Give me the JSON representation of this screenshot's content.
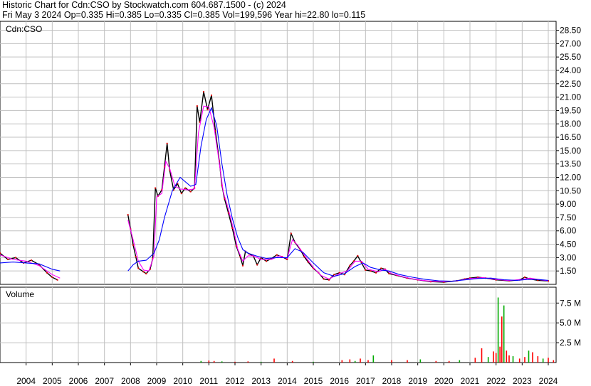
{
  "header": {
    "line1": "Historic Chart for Cdn:CSO by Stockwatch.com 604.687.1500 - (c) 2024",
    "line2": "Fri May  3 2024   Op=0.335   Hi=0.385   Lo=0.335   Cl=0.385   Vol=199,596   Year hi=22.80   lo=0.115"
  },
  "chart_data": [
    {
      "type": "line",
      "panel": "price",
      "label": "Cdn:CSO",
      "ylim": [
        0,
        29.5
      ],
      "y_ticks": [
        1.5,
        3.0,
        4.5,
        6.0,
        7.5,
        9.0,
        10.5,
        12.0,
        13.5,
        15.0,
        16.5,
        18.0,
        19.5,
        21.0,
        22.5,
        24.0,
        25.5,
        27.0,
        28.5
      ],
      "y_tick_labels": [
        "1.50",
        "3.00",
        "4.50",
        "6.00",
        "7.50",
        "9.00",
        "10.50",
        "12.00",
        "13.50",
        "15.00",
        "16.50",
        "18.00",
        "19.50",
        "21.00",
        "22.50",
        "24.00",
        "25.50",
        "27.00",
        "28.50"
      ],
      "x_ticks": [
        "2004",
        "2005",
        "2006",
        "2007",
        "2008",
        "2009",
        "2010",
        "2011",
        "2012",
        "2013",
        "2014",
        "2015",
        "2016",
        "2017",
        "2018",
        "2019",
        "2020",
        "2021",
        "2022",
        "2023",
        "2024"
      ],
      "series": [
        {
          "kind": "price",
          "color": "#000000",
          "points": [
            [
              2003.0,
              3.5
            ],
            [
              2003.3,
              2.8
            ],
            [
              2003.6,
              3.0
            ],
            [
              2003.9,
              2.4
            ],
            [
              2004.2,
              2.7
            ],
            [
              2004.5,
              2.2
            ],
            [
              2004.8,
              1.3
            ],
            [
              2005.0,
              0.8
            ],
            [
              2005.2,
              0.5
            ],
            [
              2007.9,
              7.8
            ],
            [
              2008.0,
              6.2
            ],
            [
              2008.1,
              4.4
            ],
            [
              2008.2,
              3.1
            ],
            [
              2008.3,
              1.8
            ],
            [
              2008.5,
              1.4
            ],
            [
              2008.6,
              1.2
            ],
            [
              2008.75,
              1.7
            ],
            [
              2008.85,
              2.9
            ],
            [
              2008.95,
              10.8
            ],
            [
              2009.05,
              9.9
            ],
            [
              2009.2,
              10.6
            ],
            [
              2009.3,
              13.2
            ],
            [
              2009.4,
              15.8
            ],
            [
              2009.5,
              12.8
            ],
            [
              2009.65,
              10.6
            ],
            [
              2009.8,
              11.3
            ],
            [
              2009.95,
              10.2
            ],
            [
              2010.1,
              10.8
            ],
            [
              2010.3,
              10.4
            ],
            [
              2010.45,
              10.8
            ],
            [
              2010.55,
              20.0
            ],
            [
              2010.65,
              18.2
            ],
            [
              2010.8,
              21.6
            ],
            [
              2010.95,
              19.6
            ],
            [
              2011.1,
              21.2
            ],
            [
              2011.25,
              17.2
            ],
            [
              2011.4,
              13.8
            ],
            [
              2011.5,
              11.1
            ],
            [
              2011.6,
              9.6
            ],
            [
              2011.75,
              8.0
            ],
            [
              2011.9,
              6.3
            ],
            [
              2012.05,
              4.3
            ],
            [
              2012.2,
              3.1
            ],
            [
              2012.3,
              2.1
            ],
            [
              2012.4,
              3.7
            ],
            [
              2012.55,
              3.4
            ],
            [
              2012.7,
              3.2
            ],
            [
              2012.85,
              2.2
            ],
            [
              2013.0,
              3.0
            ],
            [
              2013.2,
              2.6
            ],
            [
              2013.4,
              2.9
            ],
            [
              2013.6,
              3.3
            ],
            [
              2013.8,
              3.1
            ],
            [
              2014.0,
              2.8
            ],
            [
              2014.15,
              5.7
            ],
            [
              2014.3,
              4.7
            ],
            [
              2014.5,
              3.9
            ],
            [
              2014.65,
              3.1
            ],
            [
              2014.8,
              2.5
            ],
            [
              2015.0,
              1.8
            ],
            [
              2015.2,
              1.3
            ],
            [
              2015.4,
              0.6
            ],
            [
              2015.6,
              0.5
            ],
            [
              2015.8,
              1.1
            ],
            [
              2016.0,
              1.3
            ],
            [
              2016.2,
              1.1
            ],
            [
              2016.4,
              2.1
            ],
            [
              2016.55,
              2.6
            ],
            [
              2016.7,
              3.2
            ],
            [
              2016.85,
              2.4
            ],
            [
              2017.0,
              1.6
            ],
            [
              2017.2,
              1.5
            ],
            [
              2017.4,
              1.3
            ],
            [
              2017.6,
              1.8
            ],
            [
              2017.75,
              1.7
            ],
            [
              2017.9,
              1.2
            ],
            [
              2018.2,
              1.0
            ],
            [
              2018.6,
              0.7
            ],
            [
              2019.0,
              0.5
            ],
            [
              2019.5,
              0.3
            ],
            [
              2020.0,
              0.25
            ],
            [
              2020.5,
              0.4
            ],
            [
              2020.8,
              0.6
            ],
            [
              2021.0,
              0.7
            ],
            [
              2021.3,
              0.8
            ],
            [
              2021.6,
              0.7
            ],
            [
              2022.0,
              0.5
            ],
            [
              2022.5,
              0.4
            ],
            [
              2022.9,
              0.5
            ],
            [
              2023.1,
              0.8
            ],
            [
              2023.3,
              0.6
            ],
            [
              2023.6,
              0.45
            ],
            [
              2024.0,
              0.385
            ]
          ]
        },
        {
          "kind": "moving-average-short",
          "color": "#ff00ff",
          "points": [
            [
              2003.0,
              3.3
            ],
            [
              2003.5,
              2.8
            ],
            [
              2004.0,
              2.6
            ],
            [
              2004.5,
              2.1
            ],
            [
              2005.0,
              1.1
            ],
            [
              2005.3,
              0.7
            ],
            [
              2007.9,
              7.2
            ],
            [
              2008.1,
              5.0
            ],
            [
              2008.3,
              2.6
            ],
            [
              2008.5,
              1.6
            ],
            [
              2008.7,
              1.5
            ],
            [
              2008.9,
              3.2
            ],
            [
              2009.0,
              9.8
            ],
            [
              2009.2,
              10.2
            ],
            [
              2009.35,
              13.8
            ],
            [
              2009.5,
              13.0
            ],
            [
              2009.7,
              11.0
            ],
            [
              2009.9,
              10.7
            ],
            [
              2010.2,
              10.6
            ],
            [
              2010.45,
              10.7
            ],
            [
              2010.6,
              17.0
            ],
            [
              2010.8,
              20.0
            ],
            [
              2011.0,
              19.9
            ],
            [
              2011.2,
              17.6
            ],
            [
              2011.4,
              13.6
            ],
            [
              2011.55,
              10.4
            ],
            [
              2011.75,
              8.4
            ],
            [
              2011.95,
              6.1
            ],
            [
              2012.1,
              4.0
            ],
            [
              2012.3,
              2.6
            ],
            [
              2012.5,
              3.2
            ],
            [
              2012.7,
              3.2
            ],
            [
              2013.0,
              2.8
            ],
            [
              2013.4,
              2.8
            ],
            [
              2013.7,
              3.2
            ],
            [
              2014.0,
              2.9
            ],
            [
              2014.2,
              5.0
            ],
            [
              2014.4,
              4.4
            ],
            [
              2014.7,
              3.1
            ],
            [
              2015.0,
              1.9
            ],
            [
              2015.3,
              1.0
            ],
            [
              2015.6,
              0.6
            ],
            [
              2016.0,
              1.2
            ],
            [
              2016.3,
              1.5
            ],
            [
              2016.6,
              2.6
            ],
            [
              2016.85,
              2.6
            ],
            [
              2017.1,
              1.7
            ],
            [
              2017.5,
              1.4
            ],
            [
              2017.75,
              1.7
            ],
            [
              2018.0,
              1.2
            ],
            [
              2018.5,
              0.8
            ],
            [
              2019.0,
              0.5
            ],
            [
              2019.5,
              0.35
            ],
            [
              2020.0,
              0.3
            ],
            [
              2020.5,
              0.4
            ],
            [
              2021.0,
              0.65
            ],
            [
              2021.5,
              0.75
            ],
            [
              2022.0,
              0.55
            ],
            [
              2022.5,
              0.42
            ],
            [
              2023.0,
              0.55
            ],
            [
              2023.3,
              0.7
            ],
            [
              2023.7,
              0.5
            ],
            [
              2024.0,
              0.4
            ]
          ]
        },
        {
          "kind": "moving-average-long",
          "color": "#0000ff",
          "points": [
            [
              2003.0,
              2.4
            ],
            [
              2003.5,
              2.5
            ],
            [
              2004.0,
              2.4
            ],
            [
              2004.5,
              2.3
            ],
            [
              2005.0,
              1.7
            ],
            [
              2005.3,
              1.5
            ],
            [
              2007.9,
              1.5
            ],
            [
              2008.1,
              2.2
            ],
            [
              2008.3,
              2.6
            ],
            [
              2008.6,
              2.7
            ],
            [
              2008.9,
              3.5
            ],
            [
              2009.1,
              5.0
            ],
            [
              2009.3,
              7.5
            ],
            [
              2009.6,
              10.5
            ],
            [
              2009.9,
              12.0
            ],
            [
              2010.3,
              11.0
            ],
            [
              2010.5,
              11.2
            ],
            [
              2010.7,
              15.5
            ],
            [
              2010.9,
              18.5
            ],
            [
              2011.1,
              19.8
            ],
            [
              2011.3,
              17.8
            ],
            [
              2011.5,
              13.5
            ],
            [
              2011.7,
              10.0
            ],
            [
              2011.9,
              7.4
            ],
            [
              2012.1,
              5.3
            ],
            [
              2012.3,
              3.9
            ],
            [
              2012.5,
              3.5
            ],
            [
              2012.8,
              3.2
            ],
            [
              2013.2,
              2.9
            ],
            [
              2013.6,
              3.0
            ],
            [
              2014.0,
              3.0
            ],
            [
              2014.3,
              4.0
            ],
            [
              2014.6,
              3.6
            ],
            [
              2015.0,
              2.4
            ],
            [
              2015.4,
              1.3
            ],
            [
              2015.8,
              0.9
            ],
            [
              2016.2,
              1.2
            ],
            [
              2016.6,
              2.0
            ],
            [
              2016.9,
              2.4
            ],
            [
              2017.2,
              1.9
            ],
            [
              2017.6,
              1.6
            ],
            [
              2017.9,
              1.5
            ],
            [
              2018.3,
              1.1
            ],
            [
              2018.8,
              0.8
            ],
            [
              2019.3,
              0.55
            ],
            [
              2019.8,
              0.4
            ],
            [
              2020.3,
              0.35
            ],
            [
              2020.8,
              0.5
            ],
            [
              2021.3,
              0.65
            ],
            [
              2021.8,
              0.7
            ],
            [
              2022.3,
              0.52
            ],
            [
              2022.8,
              0.45
            ],
            [
              2023.2,
              0.55
            ],
            [
              2023.6,
              0.55
            ],
            [
              2024.0,
              0.45
            ]
          ]
        }
      ]
    },
    {
      "type": "bar",
      "panel": "volume",
      "title": "Volume",
      "ylim": [
        0,
        9.5
      ],
      "y_ticks": [
        2.5,
        5.0,
        7.5
      ],
      "y_tick_labels": [
        "2.5 M",
        "5.0 M",
        "7.5 M"
      ],
      "unit": "millions of shares",
      "bars": [
        [
          2010.7,
          0.2
        ],
        [
          2011.0,
          0.25
        ],
        [
          2011.2,
          0.2
        ],
        [
          2011.5,
          0.15
        ],
        [
          2012.0,
          0.1
        ],
        [
          2012.5,
          0.15
        ],
        [
          2013.0,
          0.1
        ],
        [
          2013.5,
          0.5
        ],
        [
          2014.2,
          0.2
        ],
        [
          2015.0,
          0.1
        ],
        [
          2016.1,
          0.3
        ],
        [
          2016.4,
          0.4
        ],
        [
          2016.6,
          0.2
        ],
        [
          2016.8,
          0.5
        ],
        [
          2017.1,
          0.3
        ],
        [
          2017.3,
          0.9
        ],
        [
          2018.0,
          0.3
        ],
        [
          2018.6,
          0.3
        ],
        [
          2019.1,
          0.4
        ],
        [
          2019.7,
          0.2
        ],
        [
          2020.2,
          0.2
        ],
        [
          2020.6,
          0.3
        ],
        [
          2021.2,
          0.6
        ],
        [
          2021.45,
          1.8
        ],
        [
          2021.7,
          0.7
        ],
        [
          2021.9,
          1.4
        ],
        [
          2022.0,
          1.2
        ],
        [
          2022.08,
          8.2
        ],
        [
          2022.15,
          2.0
        ],
        [
          2022.22,
          5.8
        ],
        [
          2022.3,
          7.2
        ],
        [
          2022.4,
          1.5
        ],
        [
          2022.5,
          0.9
        ],
        [
          2022.65,
          0.8
        ],
        [
          2022.9,
          0.5
        ],
        [
          2023.1,
          0.7
        ],
        [
          2023.25,
          1.5
        ],
        [
          2023.4,
          1.3
        ],
        [
          2023.6,
          0.8
        ],
        [
          2023.8,
          0.5
        ],
        [
          2024.0,
          0.6
        ],
        [
          2024.2,
          0.3
        ]
      ],
      "colors": {
        "up": "#00aa00",
        "down": "#ff0000"
      }
    }
  ],
  "colors": {
    "grid": "#c0c0c0",
    "axis": "#000000",
    "background": "#ffffff"
  }
}
